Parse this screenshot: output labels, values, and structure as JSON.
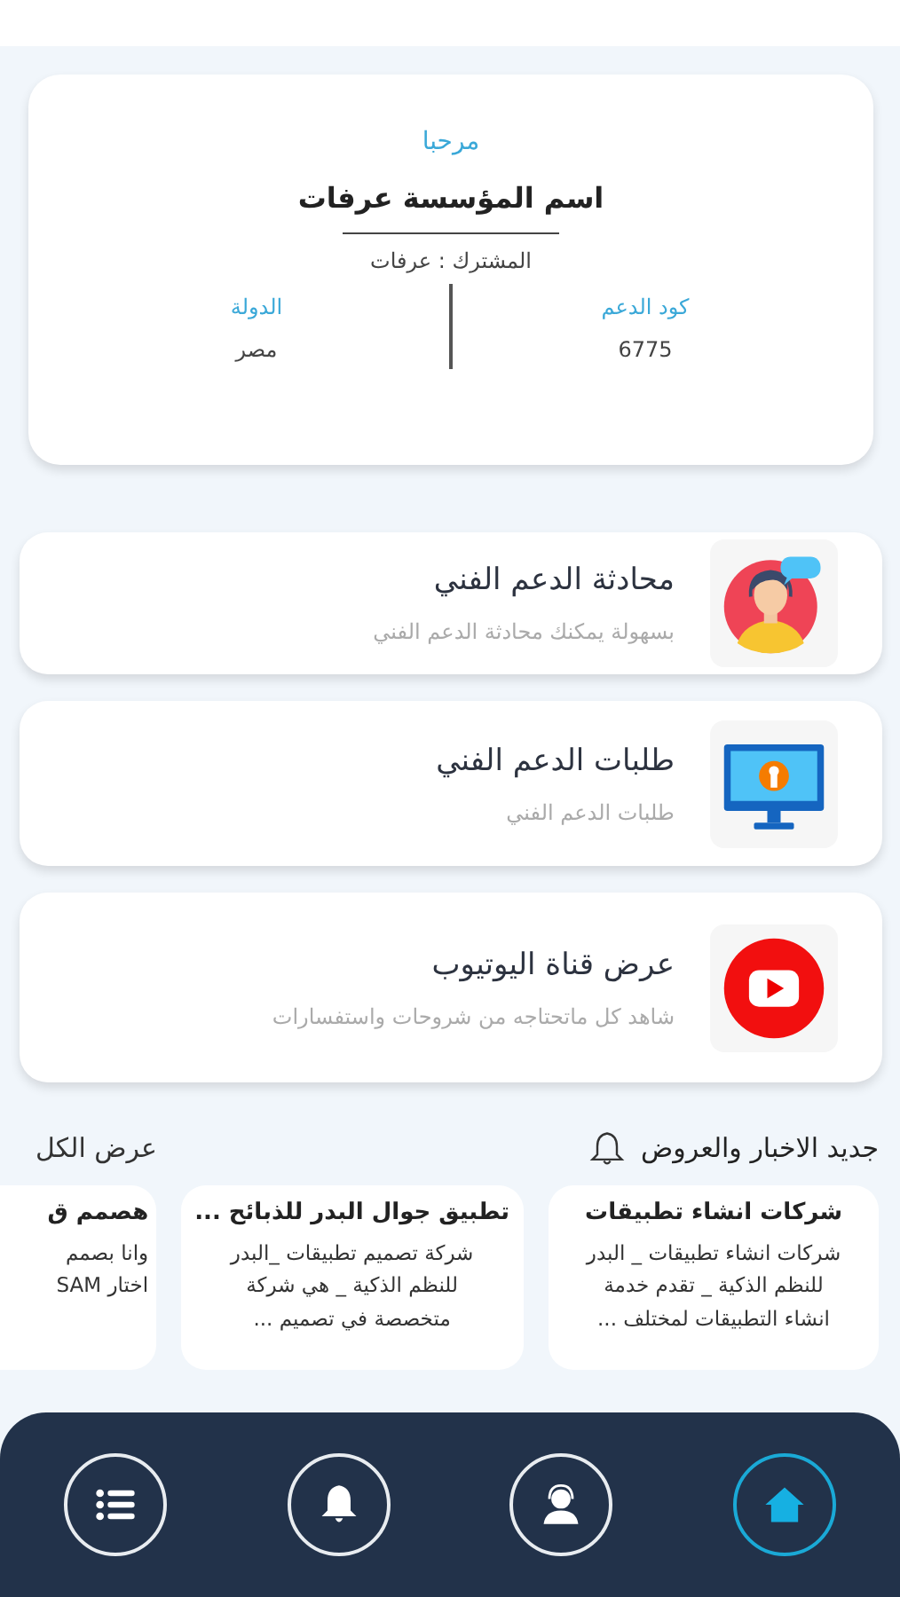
{
  "header": {
    "greeting": "مرحبا",
    "organization": "اسم المؤسسة عرفات",
    "subscriber": "المشترك : عرفات",
    "fields": [
      {
        "label": "كود الدعم",
        "value": "6775"
      },
      {
        "label": "الدولة",
        "value": "مصر"
      }
    ]
  },
  "menu": [
    {
      "kind": "support-chat",
      "title": "محادثة الدعم الفني",
      "subtitle": "بسهولة يمكنك محادثة الدعم الفني"
    },
    {
      "kind": "support-requests",
      "title": "طلبات الدعم الفني",
      "subtitle": "طلبات الدعم الفني"
    },
    {
      "kind": "youtube",
      "title": "عرض قناة اليوتيوب",
      "subtitle": "شاهد كل ماتحتاجه من شروحات واستفسارات"
    }
  ],
  "news": {
    "title": "جديد الاخبار والعروض",
    "view_all": "عرض الكل",
    "items": [
      {
        "title": "شركات انشاء تطبيقات",
        "body": "شركات انشاء تطبيقات _ البدر\nللنظم الذكية _ تقدم خدمة\nانشاء التطبيقات لمختلف ..."
      },
      {
        "title": "تطبيق جوال البدر للذبائح ...",
        "body": "شركة تصميم تطبيقات _البدر\nللنظم الذكية _ هي شركة\nمتخصصة  في تصميم ..."
      },
      {
        "title": "هصمم ق",
        "body": "وانا بصمم\nاختار SAM"
      }
    ]
  },
  "nav": [
    {
      "kind": "home",
      "selected": true
    },
    {
      "kind": "support",
      "selected": false
    },
    {
      "kind": "notifications",
      "selected": false
    },
    {
      "kind": "list",
      "selected": false
    }
  ]
}
